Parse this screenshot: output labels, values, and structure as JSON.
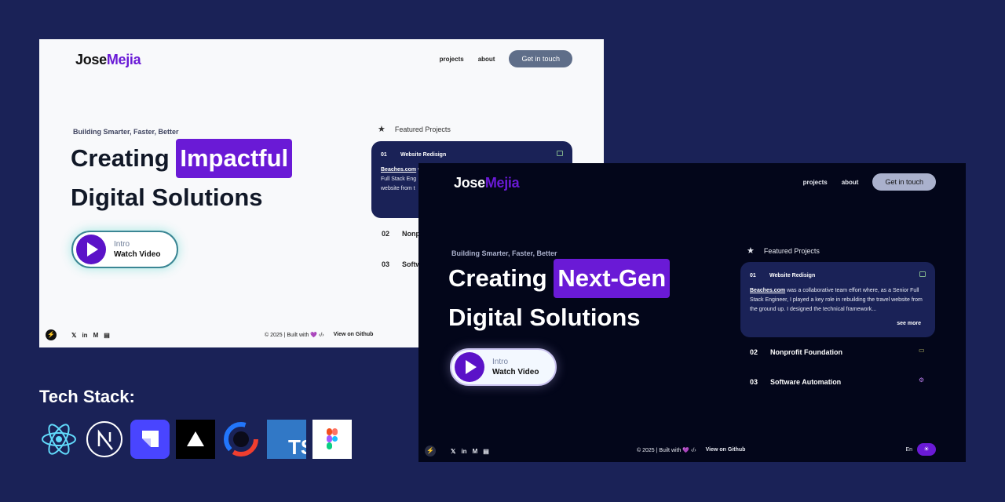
{
  "logo": {
    "first": "Jose",
    "second": "Mejia"
  },
  "nav": {
    "projects": "projects",
    "about": "about",
    "cta": "Get in touch"
  },
  "light": {
    "tagline": "Building Smarter, Faster, Better",
    "headline_pre": "Creating",
    "headline_highlight": "Impactful",
    "headline_line2": "Digital Solutions",
    "video_label": "Intro",
    "video_action": "Watch Video",
    "featured_title": "Featured Projects",
    "card": {
      "num": "01",
      "title": "Website Redisign",
      "link": "Beaches.com",
      "desc": " w\nFull Stack Eng\nwebsite from t"
    },
    "projects": [
      {
        "num": "02",
        "name": "Nonp"
      },
      {
        "num": "03",
        "name": "Softw"
      }
    ]
  },
  "dark": {
    "tagline": "Building Smarter, Faster, Better",
    "headline_pre": "Creating",
    "headline_highlight": "Next-Gen",
    "headline_line2": "Digital Solutions",
    "video_label": "Intro",
    "video_action": "Watch Video",
    "featured_title": "Featured Projects",
    "card": {
      "num": "01",
      "title": "Website Redisign",
      "link": "Beaches.com",
      "desc": " was a collaborative team effort where, as a Senior Full Stack Engineer, I played a key role in rebuilding the travel website from the ground up. I designed the technical framework...",
      "more": "see more"
    },
    "projects": [
      {
        "num": "02",
        "name": "Nonprofit Foundation"
      },
      {
        "num": "03",
        "name": "Software Automation"
      }
    ],
    "lang": "En"
  },
  "footer": {
    "copyright": "©  2025  |  Built with 💜 ‹/›",
    "github": "View on Github"
  },
  "tech": {
    "title": "Tech Stack:",
    "items": [
      "react-icon",
      "nextjs-icon",
      "strapi-icon",
      "vercel-icon",
      "sanity-icon",
      "typescript-icon",
      "figma-icon"
    ],
    "ts_label": "TS"
  },
  "colors": {
    "background": "#1a2257",
    "accent": "#6a1ad6",
    "card": "#1a2257",
    "dark_bg": "#03061a"
  }
}
